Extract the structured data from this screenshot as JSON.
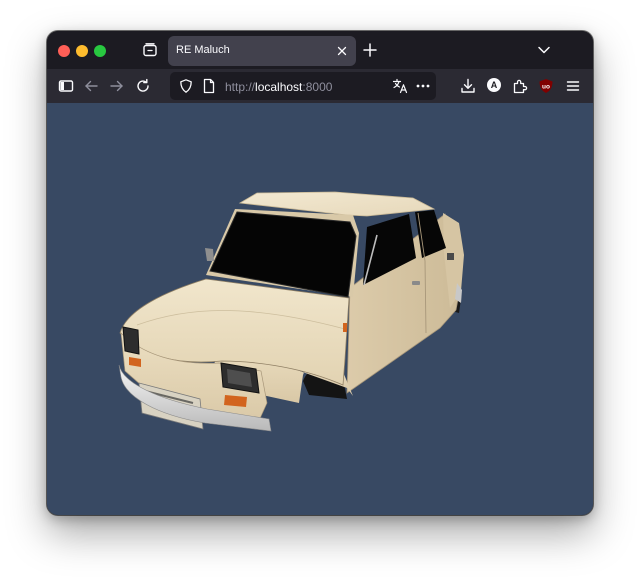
{
  "tab": {
    "title": "RE Maluch"
  },
  "address_bar": {
    "scheme": "http://",
    "host": "localhost",
    "port": ":8000"
  },
  "toolbar": {
    "account_letter": "A"
  },
  "viewport": {
    "background": "#384963"
  },
  "scene": {
    "object": "3D model of a cream Fiat 126p car body"
  }
}
